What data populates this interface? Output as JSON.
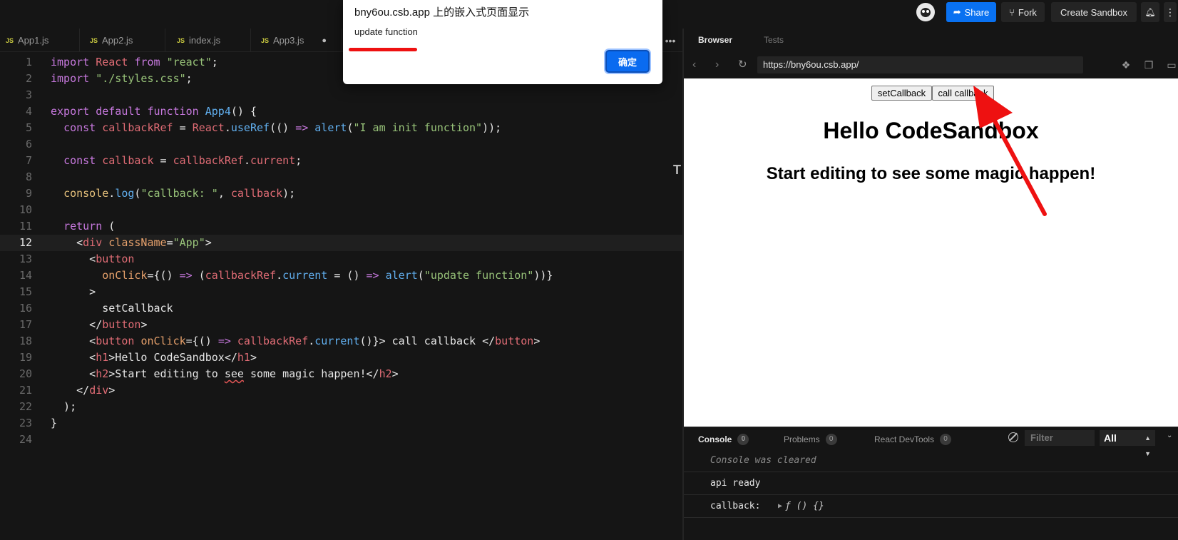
{
  "topbar": {
    "share_label": "Share",
    "fork_label": "Fork",
    "create_label": "Create Sandbox"
  },
  "editor_tabs": [
    {
      "label": "App1.js"
    },
    {
      "label": "App2.js"
    },
    {
      "label": "index.js"
    },
    {
      "label": "App3.js"
    }
  ],
  "editor": {
    "current_line": 12,
    "lines": [
      "1",
      "2",
      "3",
      "4",
      "5",
      "6",
      "7",
      "8",
      "9",
      "10",
      "11",
      "12",
      "13",
      "14",
      "15",
      "16",
      "17",
      "18",
      "19",
      "20",
      "21",
      "22",
      "23",
      "24"
    ]
  },
  "right_panel": {
    "tabs": [
      {
        "label": "Browser"
      },
      {
        "label": "Tests"
      }
    ],
    "url": "https://bny6ou.csb.app/"
  },
  "preview": {
    "buttons": [
      {
        "label": "setCallback"
      },
      {
        "label": "call callback"
      }
    ],
    "h1": "Hello CodeSandbox",
    "h2": "Start editing to see some magic happen!"
  },
  "console": {
    "tabs": [
      {
        "label": "Console",
        "count": "0"
      },
      {
        "label": "Problems",
        "count": "0"
      },
      {
        "label": "React DevTools",
        "count": "0"
      }
    ],
    "filter_placeholder": "Filter",
    "level": "All",
    "entries": [
      {
        "text": "Console was cleared"
      },
      {
        "text": "api ready"
      },
      {
        "label": "callback:",
        "value": "ƒ () {}"
      }
    ]
  },
  "dialog": {
    "title": "bny6ou.csb.app 上的嵌入式页面显示",
    "message": "update function",
    "ok_label": "确定"
  },
  "colors": {
    "accent": "#0971f1",
    "editor_bg": "#151515",
    "annotation_red": "#ee1111"
  }
}
